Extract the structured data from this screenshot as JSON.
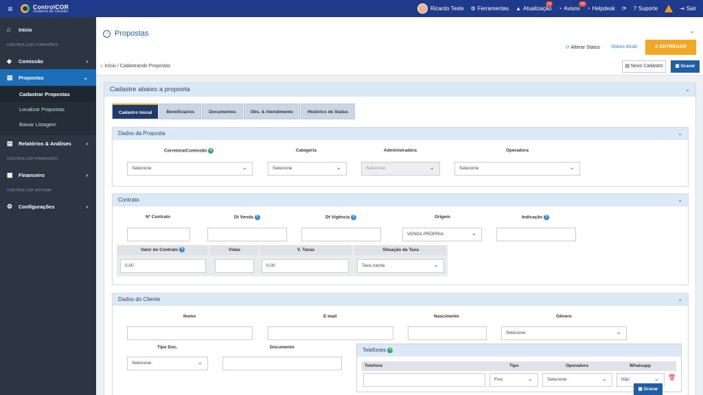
{
  "topbar": {
    "brand_name": "ControlCOR",
    "brand_sub": "Sistema de Gestão",
    "user": "Ricardo Teste",
    "tools": "Ferramentas",
    "updates": "Atualização",
    "updates_badge": "10",
    "notices": "Avisos",
    "notices_badge": "10",
    "helpdesk": "Helpdesk",
    "support": "Suporte",
    "logout": "Sair"
  },
  "sidebar": {
    "home": "Início",
    "group1": "CONTROLCOR COMISSÕES",
    "comissao": "Comissão",
    "propostas": "Propostas",
    "sub": [
      "Cadastrar Propostas",
      "Localizar Propostas",
      "Baixar Listagem"
    ],
    "relatorios": "Relatórios & Análises",
    "group2": "CONTROLCOR FINANCEIRO",
    "financeiro": "Financeiro",
    "group3": "CONTROLCOR SISTEMA",
    "config": "Configurações"
  },
  "header": {
    "title": "Propostas",
    "alter_status": "Alterar Status",
    "status_label": "Status Atual:",
    "status_value": "A ENTREGAR",
    "breadcrumb_home": "Início",
    "breadcrumb_sep": "/",
    "breadcrumb_current": "Cadastrando Propostas",
    "btn_novo": "Novo Cadastro",
    "btn_gravar": "Gravar"
  },
  "form": {
    "card_title": "Cadastre abaixo a proposta",
    "tabs": [
      "Cadastro Inicial",
      "Beneficiários",
      "Documentos",
      "Obs. & Atendimento",
      "Histórico de Status"
    ],
    "dados_proposta": {
      "title": "Dados da Proposta",
      "corretora": "Corretora/Comissão",
      "categoria": "Categoria",
      "administradora": "Administradora",
      "operadora": "Operadora",
      "select": "Selecione"
    },
    "contrato": {
      "title": "Contrato",
      "n_contrato": "Nº Contrato",
      "dt_venda": "Dt Venda",
      "dt_vigencia": "Dt Vigência",
      "origem": "Origem",
      "origem_value": "VENDA PRÓPRIA",
      "indicacao": "Indicação",
      "valor": "Valor do Contrato",
      "valor_value": "0,00",
      "vidas": "Vidas",
      "taxas": "V. Taxas",
      "taxas_value": "0,00",
      "situacao": "Situação da Taxa",
      "situacao_value": "Taxa Isenta"
    },
    "cliente": {
      "title": "Dados do Cliente",
      "nome": "Nome",
      "email": "E-mail",
      "nascimento": "Nascimento",
      "genero": "Gênero",
      "genero_value": "Selecione",
      "tipo_doc": "Tipo Doc.",
      "tipo_doc_value": "Selecione",
      "documento": "Documento"
    },
    "telefones": {
      "title": "Telefones",
      "col_tel": "Telefone",
      "col_tipo": "Tipo",
      "col_operadora": "Operadora",
      "col_whatsapp": "Whatsapp",
      "tipo_value": "Fixo",
      "operadora_value": "Selecione",
      "whatsapp_value": "Não"
    },
    "float_gravar": "Gravar"
  }
}
